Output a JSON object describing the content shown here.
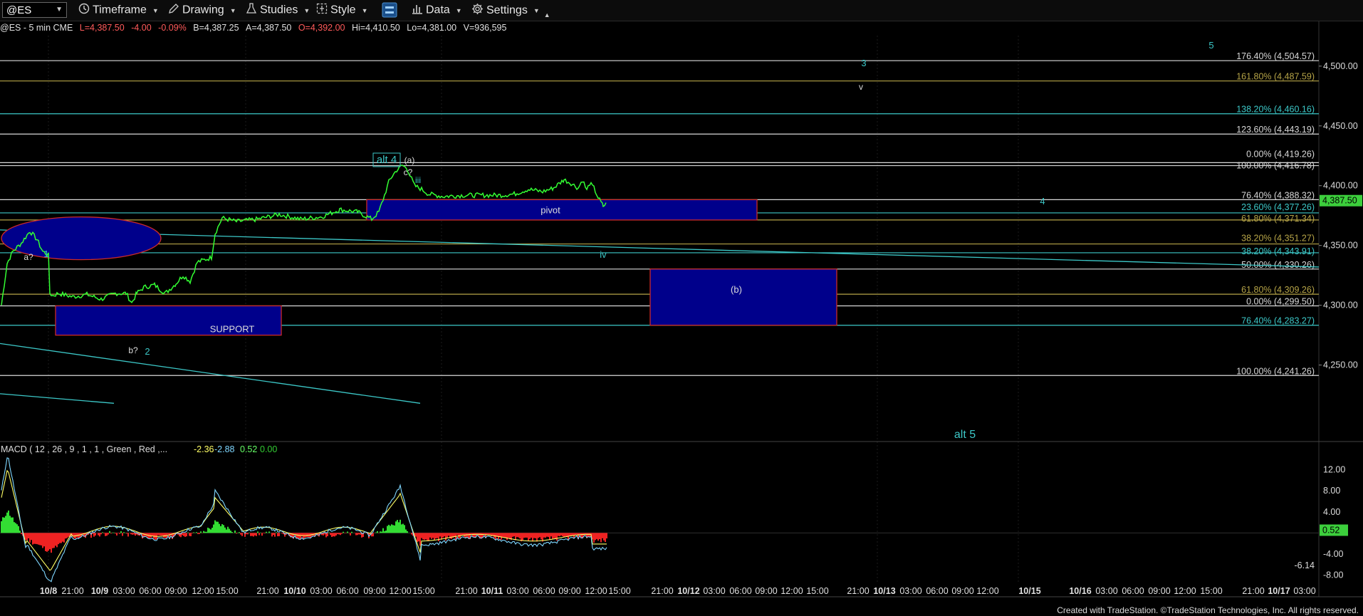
{
  "toolbar": {
    "symbol": "@ES",
    "timeframe": "Timeframe",
    "drawing": "Drawing",
    "studies": "Studies",
    "style": "Style",
    "data": "Data",
    "settings": "Settings"
  },
  "infobar": {
    "symbol_desc": "@ES - 5 min  CME",
    "last": "L=4,387.50",
    "change": "-4.00",
    "change_pct": "-0.09%",
    "bid": "B=4,387.25",
    "ask": "A=4,387.50",
    "open": "O=4,392.00",
    "high": "Hi=4,410.50",
    "low": "Lo=4,381.00",
    "volume": "V=936,595"
  },
  "colors": {
    "price_line": "#33ff33",
    "box_fill": "#00008b",
    "box_border": "#cc2a2a",
    "teal": "#3cc8c8",
    "gold": "#b6a447",
    "white_line": "#d8d8d8",
    "last_price_bg": "#3ccf3c"
  },
  "chart_data": {
    "type": "line",
    "title": "",
    "price_axis": {
      "ticks": [
        "4,500.00",
        "4,450.00",
        "4,400.00",
        "4,350.00",
        "4,300.00",
        "4,250.00"
      ],
      "tick_values": [
        4500,
        4450,
        4400,
        4350,
        4300,
        4250
      ],
      "ylim": [
        4217,
        4541
      ]
    },
    "last_price": {
      "label": "4,387.50",
      "value": 4387.5
    },
    "x_ticks": [
      "10/8",
      "21:00",
      "10/9",
      "03:00",
      "06:00",
      "09:00",
      "12:00",
      "15:00",
      "21:00",
      "10/10",
      "03:00",
      "06:00",
      "09:00",
      "12:00",
      "15:00",
      "21:00",
      "10/11",
      "03:00",
      "06:00",
      "09:00",
      "12:00",
      "15:00",
      "21:00",
      "10/12",
      "03:00",
      "06:00",
      "09:00",
      "12:00",
      "15:00",
      "21:00",
      "10/13",
      "03:00",
      "06:00",
      "09:00",
      "12:00",
      "10/15",
      "10/16",
      "03:00",
      "06:00",
      "09:00",
      "12:00",
      "15:00",
      "21:00",
      "10/17",
      "03:00"
    ],
    "fib_levels": [
      {
        "label": "176.40% (4,504.57)",
        "value": 4504.57,
        "color": "white"
      },
      {
        "label": "161.80% (4,487.59)",
        "value": 4487.59,
        "color": "gold"
      },
      {
        "label": "138.20% (4,460.16)",
        "value": 4460.16,
        "color": "teal"
      },
      {
        "label": "123.60% (4,443.19)",
        "value": 4443.19,
        "color": "white"
      },
      {
        "label": "0.00% (4,419.26)",
        "value": 4419.26,
        "color": "white"
      },
      {
        "label": "100.00% (4,416.78)",
        "value": 4416.78,
        "color": "white"
      },
      {
        "label": "76.40% (4,388.32)",
        "value": 4388.32,
        "color": "white"
      },
      {
        "label": "23.60% (4,377.26)",
        "value": 4377.26,
        "color": "teal"
      },
      {
        "label": "61.80% (4,371.34)",
        "value": 4371.34,
        "color": "gold"
      },
      {
        "label": "38.20% (4,351.27)",
        "value": 4351.27,
        "color": "gold"
      },
      {
        "label": "38.20% (4,343.91)",
        "value": 4343.91,
        "color": "teal"
      },
      {
        "label": "50.00% (4,330.26)",
        "value": 4330.26,
        "color": "white"
      },
      {
        "label": "61.80% (4,309.26)",
        "value": 4309.26,
        "color": "gold"
      },
      {
        "label": "0.00% (4,299.50)",
        "value": 4299.5,
        "color": "white"
      },
      {
        "label": "76.40% (4,283.27)",
        "value": 4283.27,
        "color": "teal"
      },
      {
        "label": "100.00% (4,241.26)",
        "value": 4241.26,
        "color": "white"
      }
    ],
    "boxes": [
      {
        "label": "SUPPORT",
        "top": 4299.5,
        "bottom": 4275
      },
      {
        "label": "pivot",
        "top": 4388.3,
        "bottom": 4371.3
      },
      {
        "label": "(b)",
        "top": 4330.3,
        "bottom": 4283.3
      }
    ],
    "wave_labels": {
      "alt4": "alt 4",
      "a_paren": "(a)",
      "c_q": "c?",
      "iii": "iii",
      "iv": "iv",
      "a_q": "a?",
      "one": "1",
      "b_q": "b?",
      "two": "2",
      "three": "3",
      "v": "v",
      "five": "5",
      "four": "4",
      "alt5": "alt 5"
    },
    "macd": {
      "label": "MACD ( 12 , 26 , 9 , 1 , 1 , Green , Red ,...",
      "values_text": [
        "-2.36",
        "-2.88",
        "0.52",
        "0.00"
      ],
      "ticks": [
        "12.00",
        "8.00",
        "4.00",
        "-4.00",
        "-8.00"
      ],
      "tick_values": [
        12,
        8,
        4,
        -4,
        -8
      ],
      "last_label": "0.52",
      "last_value": 0.52,
      "min_label": "-6.14",
      "min_value": -6.14,
      "ylim": [
        -10.5,
        16
      ]
    }
  },
  "footer": "Created with TradeStation. ©TradeStation Technologies, Inc. All rights reserved."
}
